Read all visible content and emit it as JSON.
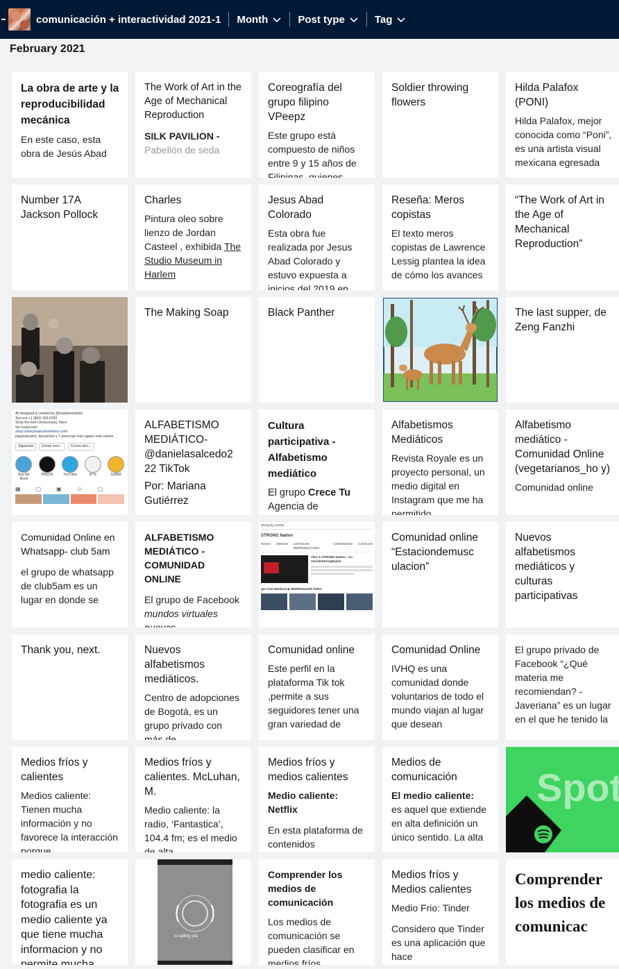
{
  "header": {
    "blog_title": "comunicación + interactividad 2021-1",
    "nav": [
      {
        "label": "Month"
      },
      {
        "label": "Post type"
      },
      {
        "label": "Tag"
      }
    ]
  },
  "month_heading": "February 2021",
  "colors": {
    "topbar": "#001935",
    "page_bg": "#f1f2f4",
    "card_bg": "#ffffff",
    "spotify_green": "#3fd35f"
  },
  "cards": [
    {
      "title": "La obra de arte y la reproducibilidad mecánica",
      "body": "En este caso, esta obra de Jesús Abad"
    },
    {
      "title": "The Work of Art in the Age of Mechanical Reproduction",
      "body": "SILK PAVILION - Pabellón de seda"
    },
    {
      "title": "Coreografía del grupo filipino VPeepz",
      "body": "Este grupo está compuesto de niños entre 9 y 15 años de Filipinas, quienes"
    },
    {
      "title": "Soldier throwing flowers"
    },
    {
      "title": "Hilda Palafox (PONI)",
      "body": "Hilda Palafox, mejor conocida como “Poni”, es una artista visual mexicana egresada"
    },
    {
      "title": "Number 17A Jackson Pollock"
    },
    {
      "title": "Charles",
      "body": "Pintura oleo sobre lienzo de Jordan Casteel , exhibida",
      "link": "The Studio Museum in Harlem"
    },
    {
      "title": "Jesus Abad Colorado",
      "body": "Esta obra fue realizada por Jesus Abad Colorado y estuvo expuesta a inicios del 2019 en"
    },
    {
      "title": "Reseña: Meros copistas",
      "body": "El texto meros copistas de Lawrence Lessig plantea la idea de cómo los avances"
    },
    {
      "title": "“The Work of Art in the Age of Mechanical Reproduction”"
    },
    {
      "image": "sculpture-photo"
    },
    {
      "title": "The Making Soap"
    },
    {
      "title": "Black Panther"
    },
    {
      "image": "deer-illustration"
    },
    {
      "title": "The last supper, de Zeng Fanzhi"
    },
    {
      "image": "instagram-screenshot",
      "lines": [
        "All designed & created by @maitybenedetto",
        "Text me +1 (802) 392-0299",
        "Shop the new Unnecessary Store",
        "Ver traducción",
        "shop.unnecessaryinventions.com/",
        "pauandreamo, benazolart y 7 personas más siguen esta cuenta"
      ],
      "buttons": [
        "Siguiendo",
        "Enviar men...",
        "Correo elec..."
      ],
      "highlights": [
        "Buy My Book",
        "PRESS",
        "YouTube",
        "BTS",
        "SUMM"
      ]
    },
    {
      "title": "ALFABETISMO MEDIÁTICO- @danielasalcedo2 22 TikTok",
      "body": "Por: Mariana Gutiérrez"
    },
    {
      "title": "Cultura participativa - Alfabetismo mediático",
      "body_pre": "El grupo ",
      "body_bold": "Crece Tu",
      "body_post": " Agencia de"
    },
    {
      "title": "Alfabetismos Mediáticos",
      "body": "Revista Royale es un proyecto personal, un medio digital en Instagram que me ha permitido"
    },
    {
      "title": "Alfabetismo mediático - Comunidad Online (vegetarianos_ho y)",
      "body": "Comunidad online"
    },
    {
      "title": "Comunidad Online en Whatsapp- club 5am",
      "body": "el grupo de whatsapp de club5am es un lugar en donde se"
    },
    {
      "title": "ALFABETISMO MEDIÁTICO - COMUNIDAD ONLINE",
      "body_pre": "El grupo de Facebook ",
      "body_italic": "mundos virtuales nuevas"
    },
    {
      "image": "youtube-screenshot",
      "search": "strong by zumba",
      "channel": "STRONG Nation",
      "tabs": [
        "INICIO",
        "VIDEOS",
        "LISTAS DE REPRODUCCIÓN",
        "COMUNIDAD",
        "CANALES"
      ],
      "video_title": "This is STRONG Nation - An #InsideStrongNation",
      "section": "get Club Workout  ▶ REPRODUCIR TODO"
    },
    {
      "title": "Comunidad online “Estaciondemusc ulacion”"
    },
    {
      "title": "Nuevos alfabetismos mediáticos y culturas participativas"
    },
    {
      "title": "Thank you, next."
    },
    {
      "title": "Nuevos alfabetismos mediáticos.",
      "body": "Centro de adopciones de Bogotá, es un grupo privado con más de"
    },
    {
      "title": "Comunidad online",
      "body": "Este perfil en la plataforma Tik tok ,permite a sus seguidores tener una gran variedad de"
    },
    {
      "title": "Comunidad Online",
      "body": "IVHQ es una comunidad donde voluntarios de todo el mundo viajan al lugar que desean"
    },
    {
      "title": "El grupo privado de Facebook “¿Qué materia me recomiendan? - Javeriana” es un lugar en el que he tenido la"
    },
    {
      "title": "Medios fríos y calientes",
      "body": "Medios caliente: Tienen mucha información y no favorece la interacción porque"
    },
    {
      "title": "Medios fríos y calientes. McLuhan, M.",
      "body": "Medio caliente: la radio, ‘Fantastica’, 104.4 fm; es el medio de alta"
    },
    {
      "title": "Medios fríos y medios calientes",
      "body_bold": "Medio caliente: Netflix",
      "body": "En esta plataforma de contenidos"
    },
    {
      "title": "Medios de comunicación",
      "body_bold": "El medio caliente:",
      "body": "es aquel que extiende en alta definición un único sentido. La alta"
    },
    {
      "image": "spotify-banner",
      "text": "Spot"
    },
    {
      "title": "medio caliente: fotografia la fotografia es un medio caliente ya que tiene mucha informacion y no permite mucha"
    },
    {
      "image": "phone-call-screenshot",
      "text": "is calling you"
    },
    {
      "title": "Comprender los medios de comunicación",
      "body": "Los medios de comunicación se pueden clasificar en medios fríos"
    },
    {
      "title": "Medios fríos y Medios calientes",
      "body": "Medio Frio: Tinder",
      "body2": "Considero que Tinder es una aplicación que hace"
    },
    {
      "title": "Comprender los medios de comunicac"
    }
  ]
}
